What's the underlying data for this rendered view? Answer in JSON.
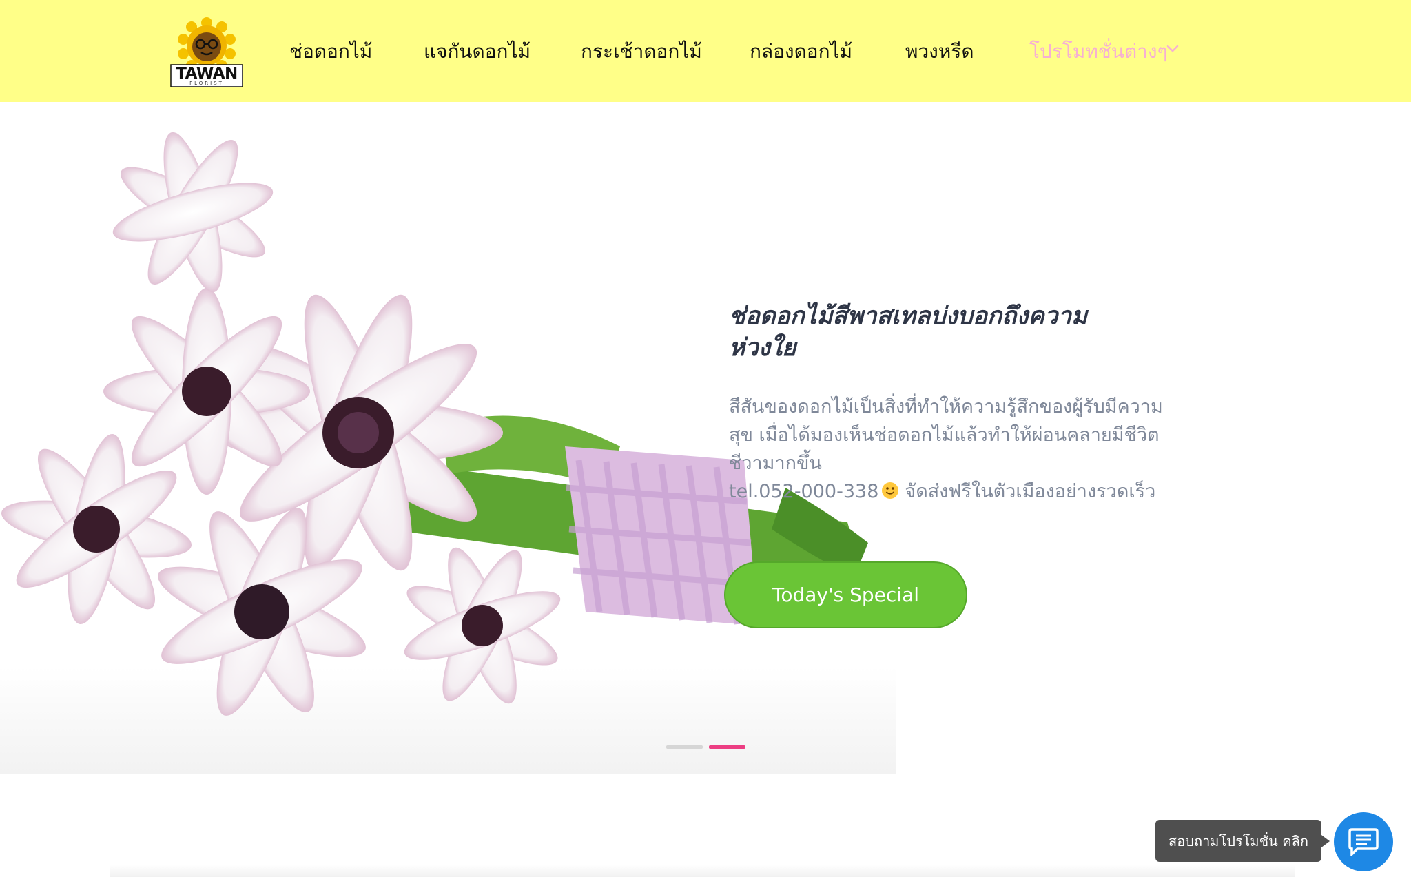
{
  "brand": {
    "logo_text": "TAWAN",
    "logo_subtext": "FLORIST"
  },
  "nav": {
    "items": [
      {
        "label": "ช่อดอกไม้"
      },
      {
        "label": "แจกันดอกไม้"
      },
      {
        "label": "กระเช้าดอกไม้"
      },
      {
        "label": "กล่องดอกไม้"
      },
      {
        "label": "พวงหรีด"
      },
      {
        "label": "โปรโมทชั่นต่างๆ"
      }
    ]
  },
  "hero": {
    "headline_line1": "ช่อดอกไม้สีพาสเทลบ่งบอกถึงความ",
    "headline_line2": "ห่วงใย",
    "desc_line1": "สีสันของดอกไม้เป็นสิ่งที่ทำให้ความรู้สึกของผู้รับมีความ",
    "desc_line2": "สุข เมื่อได้มองเห็นช่อดอกไม้แล้วทำให้ผ่อนคลายมีชีวิต",
    "desc_line3": "ชีวามากขึ้น",
    "phone": "tel.052-000-338",
    "delivery": "จัดส่งฟรีในตัวเมืองอย่างรวดเร็ว",
    "cta_label": "Today's Special",
    "slides": {
      "count": 2,
      "active": 2
    }
  },
  "chat": {
    "tooltip": "สอบถามโปรโมชั่น คลิก"
  },
  "colors": {
    "header_bg": "#ffff88",
    "promo_nav": "#f6b0d3",
    "cta_bg": "#6ac536",
    "active_dot": "#ec3e83",
    "chat_btn": "#1e88e5",
    "headline": "#2e3546"
  },
  "icons": {
    "logo": "sunflower-logo",
    "dropdown": "chevron-down-icon",
    "smiley": "smiley-face-icon",
    "chat": "chat-bubble-icon"
  }
}
